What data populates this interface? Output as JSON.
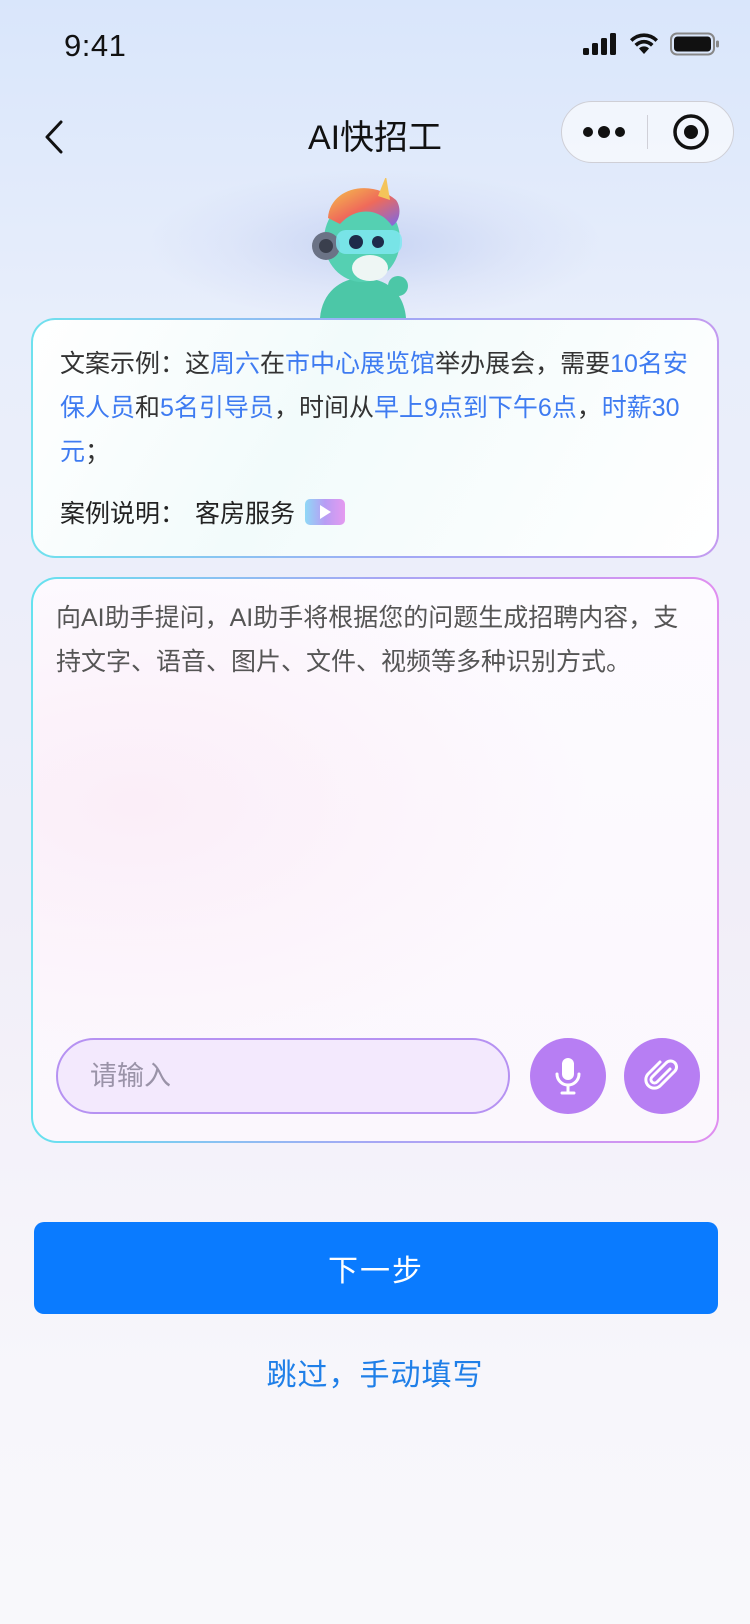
{
  "status_bar": {
    "time": "9:41"
  },
  "nav": {
    "title": "AI快招工"
  },
  "example": {
    "segments": [
      {
        "text": "文案示例：这",
        "highlight": false
      },
      {
        "text": "周六",
        "highlight": true
      },
      {
        "text": "在",
        "highlight": false
      },
      {
        "text": "市中心展览馆",
        "highlight": true
      },
      {
        "text": "举办展会，需要",
        "highlight": false
      },
      {
        "text": "10名安保人员",
        "highlight": true
      },
      {
        "text": "和",
        "highlight": false
      },
      {
        "text": "5名引导员",
        "highlight": true
      },
      {
        "text": "，时间从",
        "highlight": false
      },
      {
        "text": "早上9点到下午6点",
        "highlight": true
      },
      {
        "text": "，",
        "highlight": false
      },
      {
        "text": "时薪30元",
        "highlight": true
      },
      {
        "text": "；",
        "highlight": false
      }
    ],
    "case_label": "案例说明：",
    "case_value": "客房服务"
  },
  "input_card": {
    "prompt": "向AI助手提问，AI助手将根据您的问题生成招聘内容，支持文字、语音、图片、文件、视频等多种识别方式。",
    "placeholder": "请输入",
    "value": ""
  },
  "actions": {
    "next_label": "下一步",
    "skip_label": "跳过，手动填写"
  },
  "icons": {
    "back": "chevron-left-icon",
    "more": "more-dots-icon",
    "close": "target-circle-icon",
    "mic": "microphone-icon",
    "attach": "paperclip-icon",
    "play": "play-icon"
  },
  "colors": {
    "primary": "#0a7bff",
    "highlight": "#3e7bf1",
    "accent_purple": "#b77ef3",
    "link": "#1f7fe8"
  }
}
